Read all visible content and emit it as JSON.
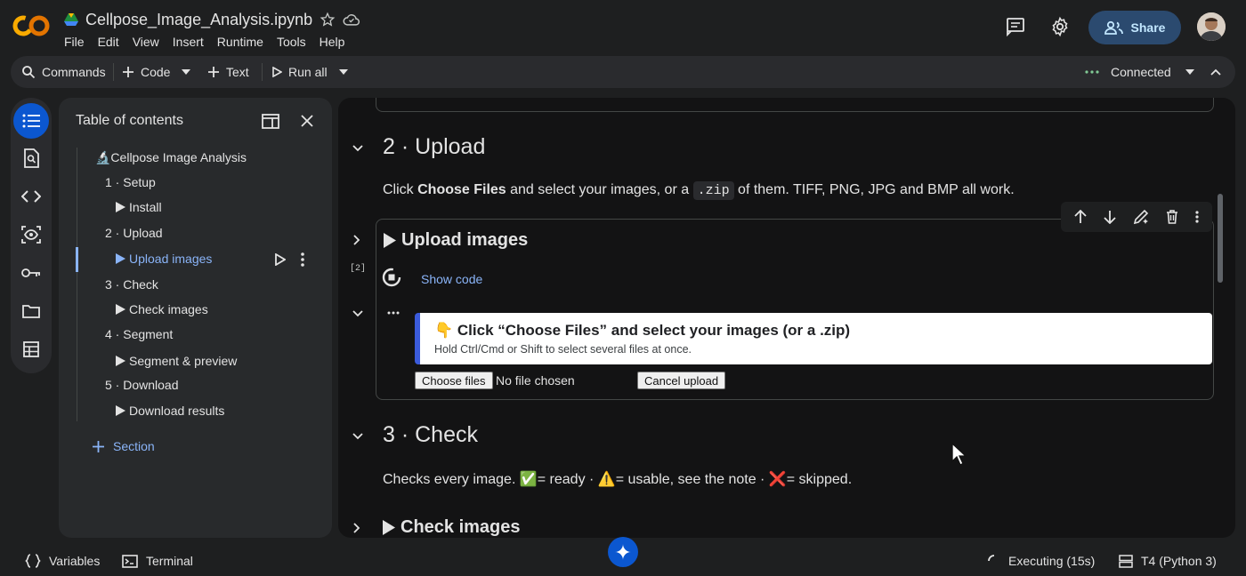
{
  "header": {
    "notebook_title": "Cellpose_Image_Analysis.ipynb",
    "menu": [
      "File",
      "Edit",
      "View",
      "Insert",
      "Runtime",
      "Tools",
      "Help"
    ],
    "share_label": "Share"
  },
  "toolbar": {
    "commands_label": "Commands",
    "code_label": "Code",
    "text_label": "Text",
    "run_all_label": "Run all",
    "connection_status": "Connected"
  },
  "toc": {
    "title": "Table of contents",
    "items": [
      {
        "label": "🔬Cellpose Image Analysis"
      },
      {
        "label": "1 · Setup"
      },
      {
        "label": "Install"
      },
      {
        "label": "2 · Upload"
      },
      {
        "label": "Upload images"
      },
      {
        "label": "3 · Check"
      },
      {
        "label": "Check images"
      },
      {
        "label": "4 · Segment"
      },
      {
        "label": "Segment & preview"
      },
      {
        "label": "5 · Download"
      },
      {
        "label": "Download results"
      }
    ],
    "add_section_label": "Section"
  },
  "notebook": {
    "upload_heading": "2 · Upload",
    "upload_text": {
      "part1": "Click ",
      "bold": "Choose Files",
      "part2": " and select your images, or a ",
      "code": ".zip",
      "part3": " of them. TIFF, PNG, JPG and BMP all work."
    },
    "upload_cell": {
      "title": "Upload images",
      "execution_count": "[2]",
      "show_code_label": "Show code",
      "output_heading": "👇 Click “Choose Files” and select your images (or a .zip)",
      "output_subtext": "Hold Ctrl/Cmd or Shift to select several files at once.",
      "choose_files_label": "Choose files",
      "no_file_label": "No file chosen",
      "cancel_upload_label": "Cancel upload"
    },
    "check_heading": "3 · Check",
    "check_text": "Checks every image. ✅= ready · ⚠️= usable, see the note · ❌= skipped.",
    "check_cell_title": "Check images"
  },
  "statusbar": {
    "variables_label": "Variables",
    "terminal_label": "Terminal",
    "execution_status": "Executing (15s)",
    "runtime_label": "T4 (Python 3)"
  },
  "colors": {
    "accent": "#0b57d0",
    "link": "#8ab4f8",
    "share_bg": "#2b4a6f",
    "logo_orange": "#f9ab00"
  }
}
